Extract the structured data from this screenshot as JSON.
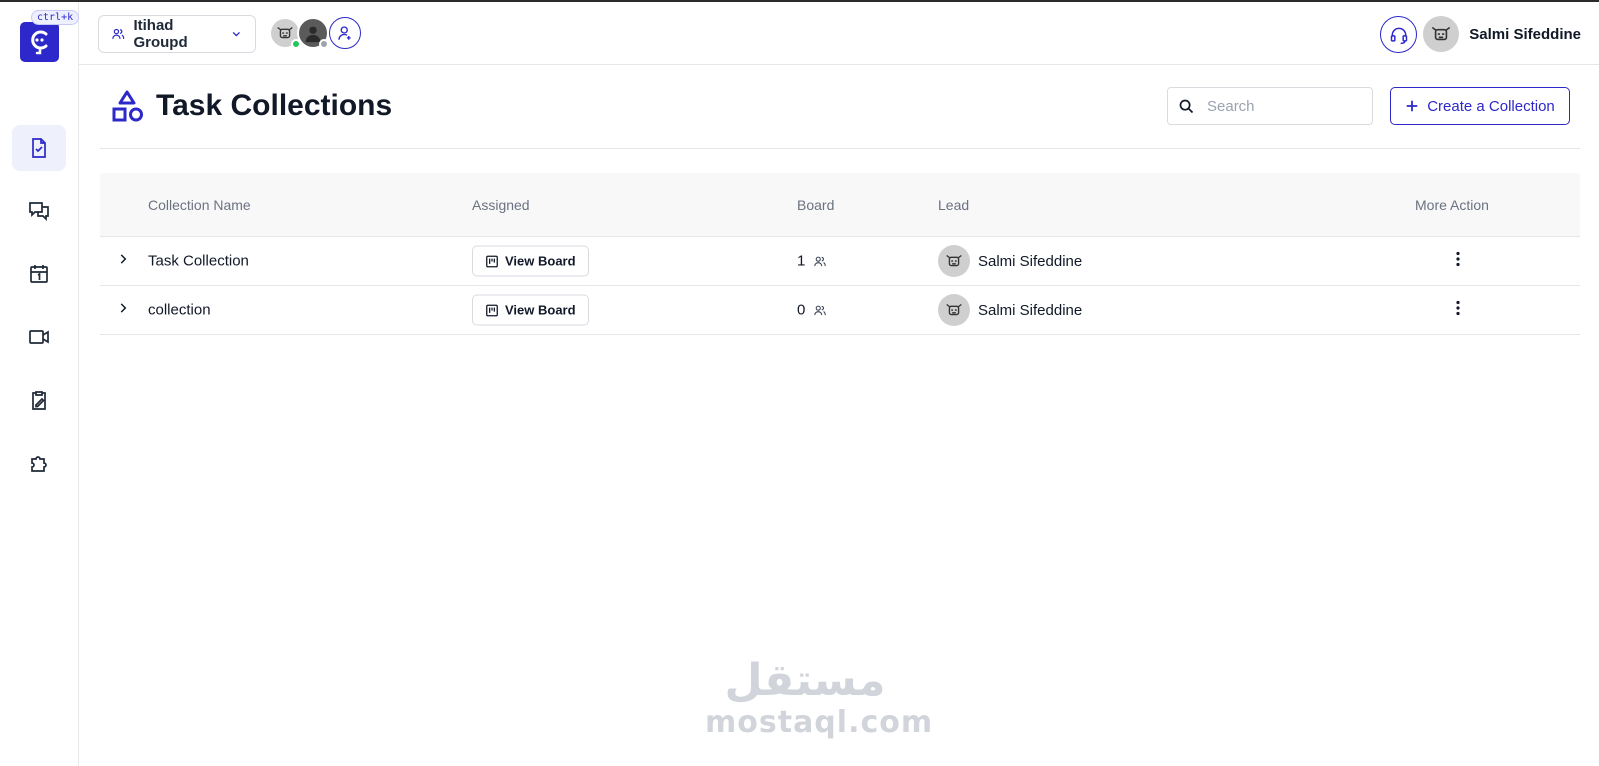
{
  "sidebar": {
    "shortcut": "ctrl+k",
    "items": [
      {
        "icon": "task-file-icon",
        "active": true
      },
      {
        "icon": "chat-icon",
        "active": false
      },
      {
        "icon": "calendar-icon",
        "active": false
      },
      {
        "icon": "video-icon",
        "active": false
      },
      {
        "icon": "clipboard-edit-icon",
        "active": false
      },
      {
        "icon": "puzzle-icon",
        "active": false
      }
    ]
  },
  "topbar": {
    "workspace": "Itihad Groupd",
    "user_name": "Salmi Sifeddine"
  },
  "page": {
    "title": "Task Collections",
    "search_placeholder": "Search",
    "create_label": "Create a Collection"
  },
  "table": {
    "headers": {
      "name": "Collection Name",
      "assigned": "Assigned",
      "board": "Board",
      "lead": "Lead",
      "more": "More Action"
    },
    "rows": [
      {
        "name": "Task Collection",
        "assigned_label": "View Board",
        "board_count": "1",
        "lead": "Salmi Sifeddine"
      },
      {
        "name": "collection",
        "assigned_label": "View Board",
        "board_count": "0",
        "lead": "Salmi Sifeddine"
      }
    ]
  },
  "watermark": {
    "arabic": "مستقل",
    "latin": "mostaql.com"
  },
  "colors": {
    "accent": "#2d28c9",
    "border": "#e5e7eb",
    "header_bg": "#f8f8f9"
  }
}
